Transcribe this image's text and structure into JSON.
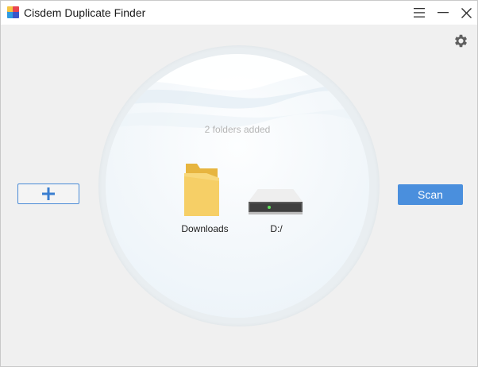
{
  "window": {
    "title": "Cisdem Duplicate Finder"
  },
  "titlebar": {
    "menu_icon": "hamburger-menu-icon",
    "minimize_icon": "minimize-icon",
    "close_icon": "close-icon"
  },
  "toolbar": {
    "settings_icon": "gear-icon"
  },
  "main": {
    "status_text": "2 folders added",
    "items": [
      {
        "label": "Downloads",
        "icon": "folder-icon"
      },
      {
        "label": "D:/",
        "icon": "hard-drive-icon"
      }
    ],
    "add_button_icon": "plus-icon",
    "scan_label": "Scan"
  },
  "colors": {
    "accent": "#4a8fdd",
    "folder": "#f3c85a"
  }
}
